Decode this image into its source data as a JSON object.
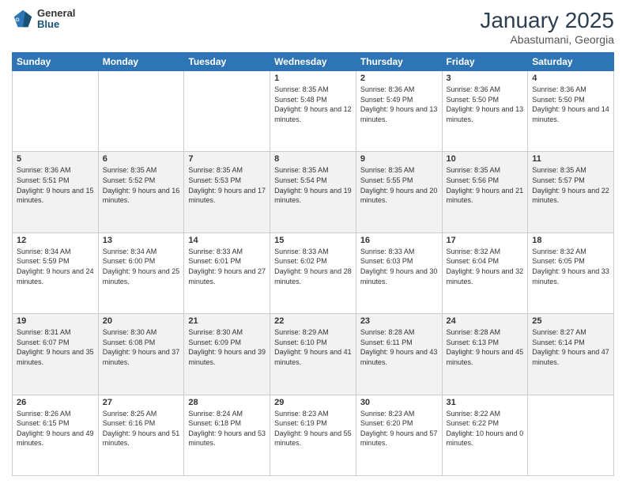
{
  "logo": {
    "general": "General",
    "blue": "Blue"
  },
  "header": {
    "month": "January 2025",
    "location": "Abastumani, Georgia"
  },
  "weekdays": [
    "Sunday",
    "Monday",
    "Tuesday",
    "Wednesday",
    "Thursday",
    "Friday",
    "Saturday"
  ],
  "weeks": [
    [
      {
        "day": "",
        "sunrise": "",
        "sunset": "",
        "daylight": ""
      },
      {
        "day": "",
        "sunrise": "",
        "sunset": "",
        "daylight": ""
      },
      {
        "day": "",
        "sunrise": "",
        "sunset": "",
        "daylight": ""
      },
      {
        "day": "1",
        "sunrise": "Sunrise: 8:35 AM",
        "sunset": "Sunset: 5:48 PM",
        "daylight": "Daylight: 9 hours and 12 minutes."
      },
      {
        "day": "2",
        "sunrise": "Sunrise: 8:36 AM",
        "sunset": "Sunset: 5:49 PM",
        "daylight": "Daylight: 9 hours and 13 minutes."
      },
      {
        "day": "3",
        "sunrise": "Sunrise: 8:36 AM",
        "sunset": "Sunset: 5:50 PM",
        "daylight": "Daylight: 9 hours and 13 minutes."
      },
      {
        "day": "4",
        "sunrise": "Sunrise: 8:36 AM",
        "sunset": "Sunset: 5:50 PM",
        "daylight": "Daylight: 9 hours and 14 minutes."
      }
    ],
    [
      {
        "day": "5",
        "sunrise": "Sunrise: 8:36 AM",
        "sunset": "Sunset: 5:51 PM",
        "daylight": "Daylight: 9 hours and 15 minutes."
      },
      {
        "day": "6",
        "sunrise": "Sunrise: 8:35 AM",
        "sunset": "Sunset: 5:52 PM",
        "daylight": "Daylight: 9 hours and 16 minutes."
      },
      {
        "day": "7",
        "sunrise": "Sunrise: 8:35 AM",
        "sunset": "Sunset: 5:53 PM",
        "daylight": "Daylight: 9 hours and 17 minutes."
      },
      {
        "day": "8",
        "sunrise": "Sunrise: 8:35 AM",
        "sunset": "Sunset: 5:54 PM",
        "daylight": "Daylight: 9 hours and 19 minutes."
      },
      {
        "day": "9",
        "sunrise": "Sunrise: 8:35 AM",
        "sunset": "Sunset: 5:55 PM",
        "daylight": "Daylight: 9 hours and 20 minutes."
      },
      {
        "day": "10",
        "sunrise": "Sunrise: 8:35 AM",
        "sunset": "Sunset: 5:56 PM",
        "daylight": "Daylight: 9 hours and 21 minutes."
      },
      {
        "day": "11",
        "sunrise": "Sunrise: 8:35 AM",
        "sunset": "Sunset: 5:57 PM",
        "daylight": "Daylight: 9 hours and 22 minutes."
      }
    ],
    [
      {
        "day": "12",
        "sunrise": "Sunrise: 8:34 AM",
        "sunset": "Sunset: 5:59 PM",
        "daylight": "Daylight: 9 hours and 24 minutes."
      },
      {
        "day": "13",
        "sunrise": "Sunrise: 8:34 AM",
        "sunset": "Sunset: 6:00 PM",
        "daylight": "Daylight: 9 hours and 25 minutes."
      },
      {
        "day": "14",
        "sunrise": "Sunrise: 8:33 AM",
        "sunset": "Sunset: 6:01 PM",
        "daylight": "Daylight: 9 hours and 27 minutes."
      },
      {
        "day": "15",
        "sunrise": "Sunrise: 8:33 AM",
        "sunset": "Sunset: 6:02 PM",
        "daylight": "Daylight: 9 hours and 28 minutes."
      },
      {
        "day": "16",
        "sunrise": "Sunrise: 8:33 AM",
        "sunset": "Sunset: 6:03 PM",
        "daylight": "Daylight: 9 hours and 30 minutes."
      },
      {
        "day": "17",
        "sunrise": "Sunrise: 8:32 AM",
        "sunset": "Sunset: 6:04 PM",
        "daylight": "Daylight: 9 hours and 32 minutes."
      },
      {
        "day": "18",
        "sunrise": "Sunrise: 8:32 AM",
        "sunset": "Sunset: 6:05 PM",
        "daylight": "Daylight: 9 hours and 33 minutes."
      }
    ],
    [
      {
        "day": "19",
        "sunrise": "Sunrise: 8:31 AM",
        "sunset": "Sunset: 6:07 PM",
        "daylight": "Daylight: 9 hours and 35 minutes."
      },
      {
        "day": "20",
        "sunrise": "Sunrise: 8:30 AM",
        "sunset": "Sunset: 6:08 PM",
        "daylight": "Daylight: 9 hours and 37 minutes."
      },
      {
        "day": "21",
        "sunrise": "Sunrise: 8:30 AM",
        "sunset": "Sunset: 6:09 PM",
        "daylight": "Daylight: 9 hours and 39 minutes."
      },
      {
        "day": "22",
        "sunrise": "Sunrise: 8:29 AM",
        "sunset": "Sunset: 6:10 PM",
        "daylight": "Daylight: 9 hours and 41 minutes."
      },
      {
        "day": "23",
        "sunrise": "Sunrise: 8:28 AM",
        "sunset": "Sunset: 6:11 PM",
        "daylight": "Daylight: 9 hours and 43 minutes."
      },
      {
        "day": "24",
        "sunrise": "Sunrise: 8:28 AM",
        "sunset": "Sunset: 6:13 PM",
        "daylight": "Daylight: 9 hours and 45 minutes."
      },
      {
        "day": "25",
        "sunrise": "Sunrise: 8:27 AM",
        "sunset": "Sunset: 6:14 PM",
        "daylight": "Daylight: 9 hours and 47 minutes."
      }
    ],
    [
      {
        "day": "26",
        "sunrise": "Sunrise: 8:26 AM",
        "sunset": "Sunset: 6:15 PM",
        "daylight": "Daylight: 9 hours and 49 minutes."
      },
      {
        "day": "27",
        "sunrise": "Sunrise: 8:25 AM",
        "sunset": "Sunset: 6:16 PM",
        "daylight": "Daylight: 9 hours and 51 minutes."
      },
      {
        "day": "28",
        "sunrise": "Sunrise: 8:24 AM",
        "sunset": "Sunset: 6:18 PM",
        "daylight": "Daylight: 9 hours and 53 minutes."
      },
      {
        "day": "29",
        "sunrise": "Sunrise: 8:23 AM",
        "sunset": "Sunset: 6:19 PM",
        "daylight": "Daylight: 9 hours and 55 minutes."
      },
      {
        "day": "30",
        "sunrise": "Sunrise: 8:23 AM",
        "sunset": "Sunset: 6:20 PM",
        "daylight": "Daylight: 9 hours and 57 minutes."
      },
      {
        "day": "31",
        "sunrise": "Sunrise: 8:22 AM",
        "sunset": "Sunset: 6:22 PM",
        "daylight": "Daylight: 10 hours and 0 minutes."
      },
      {
        "day": "",
        "sunrise": "",
        "sunset": "",
        "daylight": ""
      }
    ]
  ]
}
